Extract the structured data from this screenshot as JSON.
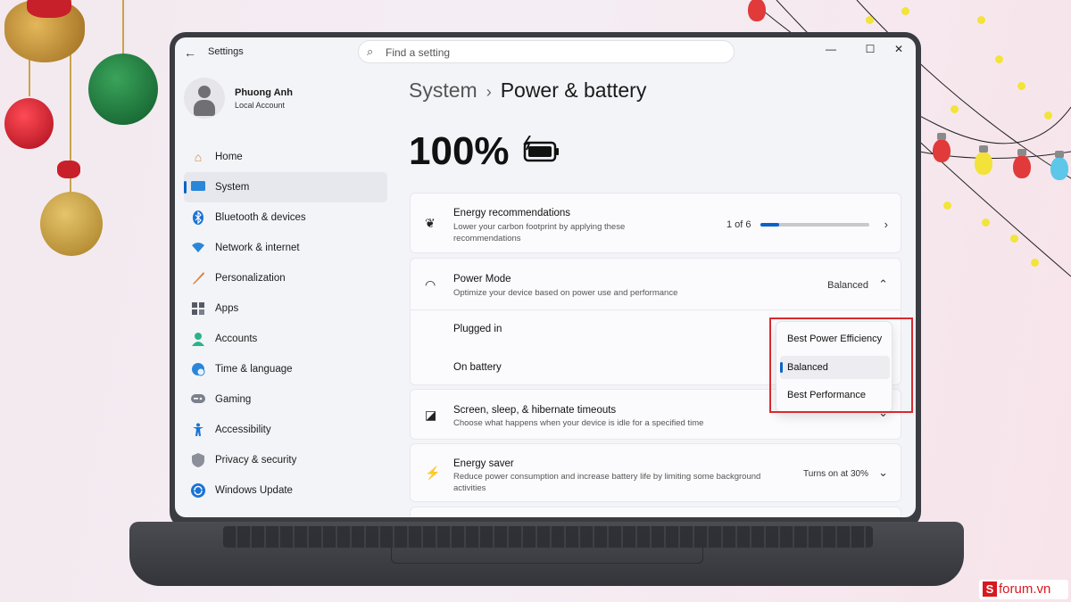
{
  "colors": {
    "accent": "#0a63c8",
    "highlight": "#d92a2f",
    "brand": "#d71920"
  },
  "window": {
    "title": "Settings",
    "search_placeholder": "Find a setting",
    "buttons": {
      "minimize": "—",
      "maximize": "☐",
      "close": "✕"
    }
  },
  "user": {
    "name": "Phuong Anh",
    "account_type": "Local Account"
  },
  "sidebar": {
    "items": [
      {
        "label": "Home",
        "icon": "home-icon",
        "active": false
      },
      {
        "label": "System",
        "icon": "system-icon",
        "active": true
      },
      {
        "label": "Bluetooth & devices",
        "icon": "bluetooth-icon",
        "active": false
      },
      {
        "label": "Network & internet",
        "icon": "wifi-icon",
        "active": false
      },
      {
        "label": "Personalization",
        "icon": "brush-icon",
        "active": false
      },
      {
        "label": "Apps",
        "icon": "apps-icon",
        "active": false
      },
      {
        "label": "Accounts",
        "icon": "person-icon",
        "active": false
      },
      {
        "label": "Time & language",
        "icon": "globe-clock-icon",
        "active": false
      },
      {
        "label": "Gaming",
        "icon": "gamepad-icon",
        "active": false
      },
      {
        "label": "Accessibility",
        "icon": "accessibility-icon",
        "active": false
      },
      {
        "label": "Privacy & security",
        "icon": "shield-icon",
        "active": false
      },
      {
        "label": "Windows Update",
        "icon": "update-icon",
        "active": false
      }
    ]
  },
  "main": {
    "breadcrumb_parent": "System",
    "breadcrumb_separator": "›",
    "page_title": "Power & battery",
    "battery_percent": "100%",
    "energy_recommendations": {
      "title": "Energy recommendations",
      "description": "Lower your carbon footprint by applying these recommendations",
      "progress_text": "1 of 6",
      "progress_fraction": 0.17
    },
    "power_mode": {
      "title": "Power Mode",
      "description": "Optimize your device based on power use and performance",
      "value": "Balanced",
      "rows": [
        {
          "label": "Plugged in"
        },
        {
          "label": "On battery"
        }
      ],
      "options": [
        "Best Power Efficiency",
        "Balanced",
        "Best Performance"
      ],
      "selected_option": "Balanced"
    },
    "screen_sleep": {
      "title": "Screen, sleep, & hibernate timeouts",
      "description": "Choose what happens when your device is idle for a specified time"
    },
    "energy_saver": {
      "title": "Energy saver",
      "description": "Reduce power consumption and increase battery life by limiting some background activities",
      "value": "Turns on at 30%"
    }
  },
  "watermark": {
    "mark": "S",
    "text": "forum.vn"
  }
}
